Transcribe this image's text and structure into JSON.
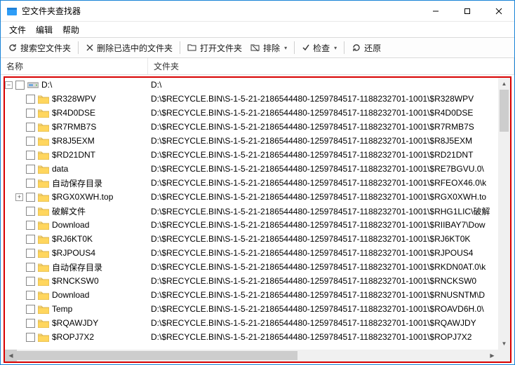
{
  "window": {
    "title": "空文件夹查找器"
  },
  "menu": {
    "file": "文件",
    "edit": "编辑",
    "help": "帮助"
  },
  "toolbar": {
    "search": "搜索空文件夹",
    "delete": "删除已选中的文件夹",
    "open": "打开文件夹",
    "sort": "排除",
    "check": "检查",
    "restore": "还原"
  },
  "headers": {
    "name": "名称",
    "folder": "文件夹"
  },
  "root": {
    "label": "D:\\",
    "path": "D:\\"
  },
  "rows": [
    {
      "exp": "",
      "name": "$R328WPV",
      "path": "D:\\$RECYCLE.BIN\\S-1-5-21-2186544480-1259784517-1188232701-1001\\$R328WPV"
    },
    {
      "exp": "",
      "name": "$R4D0DSE",
      "path": "D:\\$RECYCLE.BIN\\S-1-5-21-2186544480-1259784517-1188232701-1001\\$R4D0DSE"
    },
    {
      "exp": "",
      "name": "$R7RMB7S",
      "path": "D:\\$RECYCLE.BIN\\S-1-5-21-2186544480-1259784517-1188232701-1001\\$R7RMB7S"
    },
    {
      "exp": "",
      "name": "$R8J5EXM",
      "path": "D:\\$RECYCLE.BIN\\S-1-5-21-2186544480-1259784517-1188232701-1001\\$R8J5EXM"
    },
    {
      "exp": "",
      "name": "$RD21DNT",
      "path": "D:\\$RECYCLE.BIN\\S-1-5-21-2186544480-1259784517-1188232701-1001\\$RD21DNT"
    },
    {
      "exp": "",
      "name": "data",
      "path": "D:\\$RECYCLE.BIN\\S-1-5-21-2186544480-1259784517-1188232701-1001\\$RE7BGVU.0\\"
    },
    {
      "exp": "",
      "name": "自动保存目录",
      "path": "D:\\$RECYCLE.BIN\\S-1-5-21-2186544480-1259784517-1188232701-1001\\$RFEOX46.0\\k"
    },
    {
      "exp": "+",
      "name": "$RGX0XWH.top",
      "path": "D:\\$RECYCLE.BIN\\S-1-5-21-2186544480-1259784517-1188232701-1001\\$RGX0XWH.to"
    },
    {
      "exp": "",
      "name": "破解文件",
      "path": "D:\\$RECYCLE.BIN\\S-1-5-21-2186544480-1259784517-1188232701-1001\\$RHG1LIC\\破解"
    },
    {
      "exp": "",
      "name": "Download",
      "path": "D:\\$RECYCLE.BIN\\S-1-5-21-2186544480-1259784517-1188232701-1001\\$RIIBAY7\\Dow"
    },
    {
      "exp": "",
      "name": "$RJ6KT0K",
      "path": "D:\\$RECYCLE.BIN\\S-1-5-21-2186544480-1259784517-1188232701-1001\\$RJ6KT0K"
    },
    {
      "exp": "",
      "name": "$RJPOUS4",
      "path": "D:\\$RECYCLE.BIN\\S-1-5-21-2186544480-1259784517-1188232701-1001\\$RJPOUS4"
    },
    {
      "exp": "",
      "name": "自动保存目录",
      "path": "D:\\$RECYCLE.BIN\\S-1-5-21-2186544480-1259784517-1188232701-1001\\$RKDN0AT.0\\k"
    },
    {
      "exp": "",
      "name": "$RNCKSW0",
      "path": "D:\\$RECYCLE.BIN\\S-1-5-21-2186544480-1259784517-1188232701-1001\\$RNCKSW0"
    },
    {
      "exp": "",
      "name": "Download",
      "path": "D:\\$RECYCLE.BIN\\S-1-5-21-2186544480-1259784517-1188232701-1001\\$RNUSNTM\\D"
    },
    {
      "exp": "",
      "name": "Temp",
      "path": "D:\\$RECYCLE.BIN\\S-1-5-21-2186544480-1259784517-1188232701-1001\\$ROAVD6H.0\\"
    },
    {
      "exp": "",
      "name": "$RQAWJDY",
      "path": "D:\\$RECYCLE.BIN\\S-1-5-21-2186544480-1259784517-1188232701-1001\\$RQAWJDY"
    },
    {
      "exp": "",
      "name": "$ROPJ7X2",
      "path": "D:\\$RECYCLE.BIN\\S-1-5-21-2186544480-1259784517-1188232701-1001\\$ROPJ7X2"
    }
  ]
}
